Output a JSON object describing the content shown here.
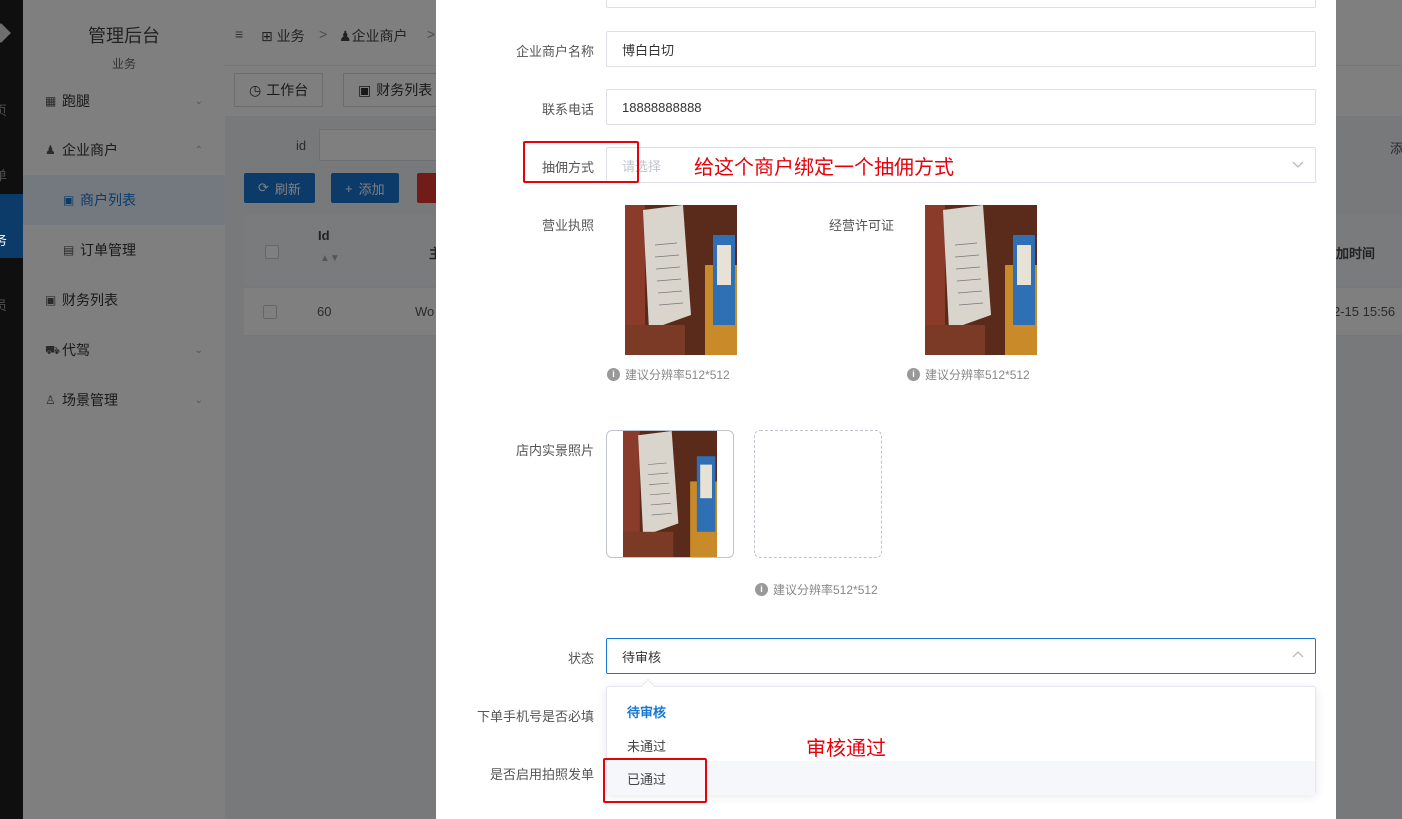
{
  "sidebar": {
    "app_title": "管理后台",
    "section": "业务",
    "stripe_chars": [
      "页",
      "单",
      "务",
      "员"
    ],
    "items": [
      {
        "label": "跑腿",
        "icon": "runner-icon",
        "expanded": false
      },
      {
        "label": "企业商户",
        "icon": "users-icon",
        "expanded": true
      },
      {
        "label": "商户列表",
        "icon": "id-card-icon",
        "child": true,
        "active": true
      },
      {
        "label": "订单管理",
        "icon": "order-icon",
        "child": true
      },
      {
        "label": "财务列表",
        "icon": "id-card-icon"
      },
      {
        "label": "代驾",
        "icon": "car-icon",
        "expanded": false
      },
      {
        "label": "场景管理",
        "icon": "user-icon",
        "expanded": false
      }
    ]
  },
  "breadcrumb": {
    "items": [
      "业务",
      "企业商户"
    ],
    "sep": ">"
  },
  "tabs": {
    "workbench": "工作台",
    "finance": "财务列表"
  },
  "search": {
    "id_label": "id",
    "right_label": "添"
  },
  "toolbar": {
    "refresh": "刷新",
    "add": "添加"
  },
  "table": {
    "headers": {
      "id": "Id",
      "main": "主",
      "add_time": "加时间"
    },
    "rows": [
      {
        "id": "60",
        "main": "Wo",
        "add_time": "2-15 15:56"
      }
    ]
  },
  "form": {
    "merchant_name_label": "企业商户名称",
    "merchant_name_value": "博白白切",
    "phone_label": "联系电话",
    "phone_value": "18888888888",
    "commission_label": "抽佣方式",
    "commission_placeholder": "请选择",
    "license_label": "营业执照",
    "permit_label": "经营许可证",
    "store_photo_label": "店内实景照片",
    "hint": "建议分辨率512*512",
    "status_label": "状态",
    "status_value": "待审核",
    "phone_required_label": "下单手机号是否必填",
    "photo_order_label": "是否启用拍照发单"
  },
  "status_options": [
    {
      "label": "待审核",
      "selected": true
    },
    {
      "label": "未通过",
      "selected": false
    },
    {
      "label": "已通过",
      "selected": false,
      "hover": true
    }
  ],
  "annotations": {
    "commission_note": "给这个商户绑定一个抽佣方式",
    "approve_note": "审核通过"
  },
  "colors": {
    "primary": "#1976d2",
    "annotation": "#e8000b",
    "danger": "#e53935"
  }
}
